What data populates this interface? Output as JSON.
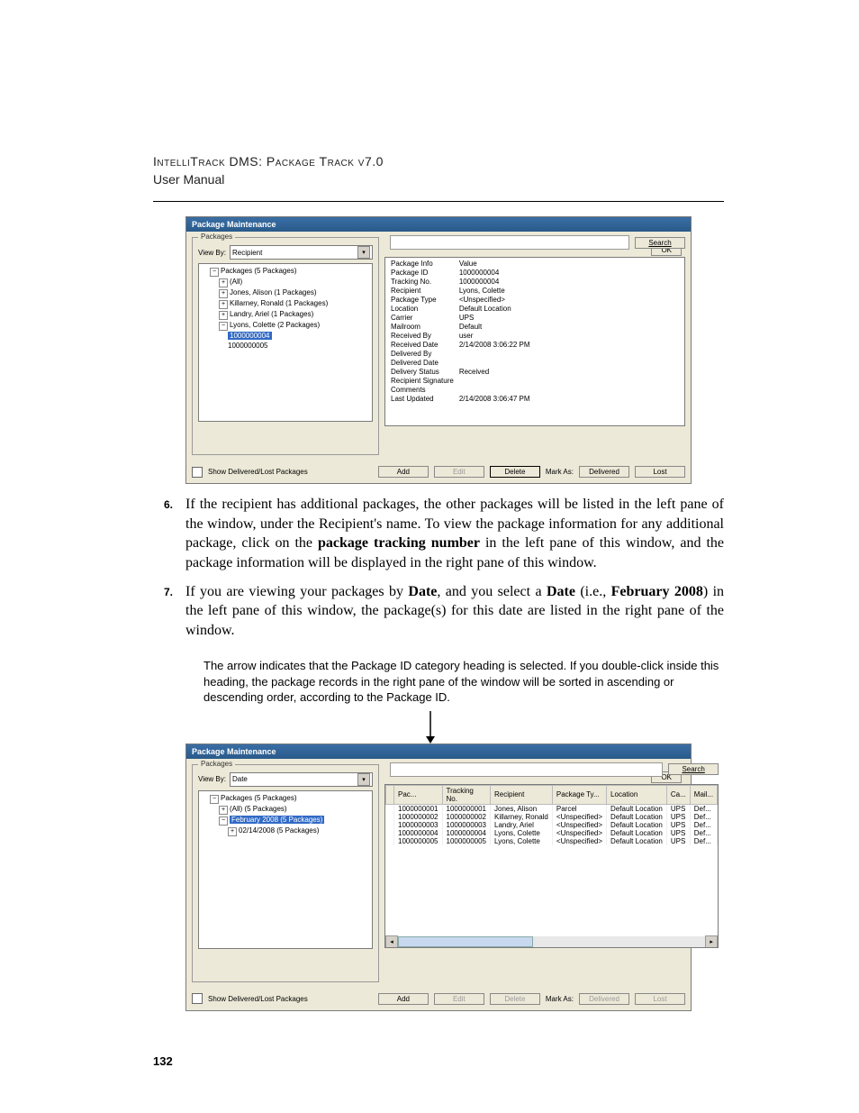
{
  "doc": {
    "product_line": "IntelliTrack DMS: Package Track v7.0",
    "manual_label": "User Manual",
    "page_number": "132"
  },
  "fig1": {
    "window_title": "Package Maintenance",
    "ok_label": "OK",
    "group_label": "Packages",
    "viewby_label": "View By:",
    "viewby_value": "Recipient",
    "search_label": "Search",
    "tree": {
      "root": "Packages (5 Packages)",
      "items": [
        "(All)",
        "Jones, Alison (1 Packages)",
        "Killarney, Ronald (1 Packages)",
        "Landry, Ariel (1 Packages)",
        "Lyons, Colette (2 Packages)"
      ],
      "leaf_a": "1000000004",
      "leaf_b": "1000000005"
    },
    "info_head_field": "Package Info",
    "info_head_value": "Value",
    "info": [
      {
        "f": "Package ID",
        "v": "1000000004"
      },
      {
        "f": "Tracking No.",
        "v": "1000000004"
      },
      {
        "f": "Recipient",
        "v": "Lyons, Colette"
      },
      {
        "f": "Package Type",
        "v": "<Unspecified>"
      },
      {
        "f": "Location",
        "v": "Default Location"
      },
      {
        "f": "Carrier",
        "v": "UPS"
      },
      {
        "f": "Mailroom",
        "v": "Default"
      },
      {
        "f": "Received By",
        "v": "user"
      },
      {
        "f": "Received Date",
        "v": "2/14/2008 3:06:22 PM"
      },
      {
        "f": "Delivered By",
        "v": ""
      },
      {
        "f": "Delivered Date",
        "v": ""
      },
      {
        "f": "Delivery Status",
        "v": "Received"
      },
      {
        "f": "Recipient Signature",
        "v": ""
      },
      {
        "f": "Comments",
        "v": ""
      },
      {
        "f": "Last Updated",
        "v": "2/14/2008 3:06:47 PM"
      }
    ],
    "show_label": "Show Delivered/Lost Packages",
    "buttons": {
      "add": "Add",
      "edit": "Edit",
      "delete": "Delete",
      "markas": "Mark As:",
      "delivered": "Delivered",
      "lost": "Lost"
    }
  },
  "step6": {
    "num": "6.",
    "text_a": "If the recipient has additional packages, the other packages will be listed in the left pane of the window, under the Recipient's name. To view the package information for any additional package, click on the ",
    "bold": "package tracking number",
    "text_b": " in the left pane of this window, and the package information will be displayed in the right pane of this window."
  },
  "step7": {
    "num": "7.",
    "a": "If you are viewing your packages by ",
    "b1": "Date",
    "b": ", and you select a ",
    "b2": "Date",
    "c": " (i.e., ",
    "b3": "February 2008",
    "d": ") in the left pane of this window, the package(s) for this date are listed in the right pane of the window."
  },
  "callout": "The arrow indicates that the Package ID category heading is selected. If you double-click inside this heading, the package records in the right pane of the window will be sorted in ascending or descending order, according to the Package ID.",
  "fig2": {
    "window_title": "Package Maintenance",
    "ok_label": "OK",
    "group_label": "Packages",
    "viewby_label": "View By:",
    "viewby_value": "Date",
    "search_label": "Search",
    "tree": {
      "root": "Packages (5 Packages)",
      "all": "(All) (5 Packages)",
      "month": "February 2008 (5 Packages)",
      "day": "02/14/2008 (5 Packages)"
    },
    "cols": [
      "",
      "Pac...",
      "Tracking No.",
      "Recipient",
      "Package Ty...",
      "Location",
      "Ca...",
      "Mail..."
    ],
    "rows": [
      [
        "",
        "1000000001",
        "1000000001",
        "Jones, Alison",
        "Parcel",
        "Default Location",
        "UPS",
        "Def..."
      ],
      [
        "",
        "1000000002",
        "1000000002",
        "Killarney, Ronald",
        "<Unspecified>",
        "Default Location",
        "UPS",
        "Def..."
      ],
      [
        "",
        "1000000003",
        "1000000003",
        "Landry, Ariel",
        "<Unspecified>",
        "Default Location",
        "UPS",
        "Def..."
      ],
      [
        "",
        "1000000004",
        "1000000004",
        "Lyons, Colette",
        "<Unspecified>",
        "Default Location",
        "UPS",
        "Def..."
      ],
      [
        "",
        "1000000005",
        "1000000005",
        "Lyons, Colette",
        "<Unspecified>",
        "Default Location",
        "UPS",
        "Def..."
      ]
    ],
    "show_label": "Show Delivered/Lost Packages",
    "buttons": {
      "add": "Add",
      "edit": "Edit",
      "delete": "Delete",
      "markas": "Mark As:",
      "delivered": "Delivered",
      "lost": "Lost"
    }
  }
}
